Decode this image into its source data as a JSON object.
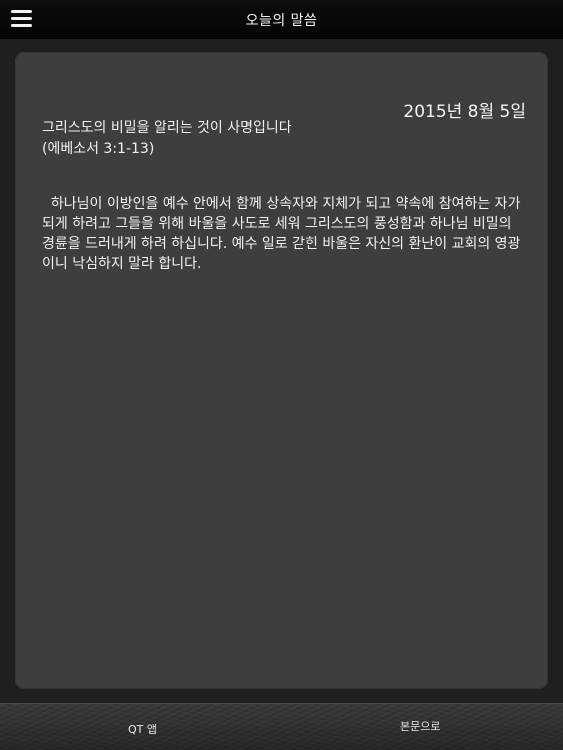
{
  "nav": {
    "title": "오늘의 말씀",
    "menu_icon": "hamburger-menu-icon"
  },
  "devotion": {
    "date": "2015년 8월 5일",
    "title": "그리스도의 비밀을 알리는 것이 사명입니다",
    "reference": "(에베소서  3:1-13)",
    "body": "  하나님이 이방인을 예수 안에서 함께 상속자와 지체가 되고 약속에 참여하는 자가 되게 하려고 그들을 위해 바울을 사도로 세워 그리스도의 풍성함과 하나님 비밀의 경륜을 드러내게 하려 하십니다. 예수 일로 갇힌 바울은 자신의 환난이 교회의 영광이니 낙심하지 말라 합니다."
  },
  "tabs": {
    "qt_app": "QT 앱",
    "scripture": "본문으로"
  },
  "colors": {
    "nav_background": "#0a0a0a",
    "card_background": "#3e3e3e",
    "page_background": "#1f1f1f",
    "text": "#f2f2f2"
  }
}
